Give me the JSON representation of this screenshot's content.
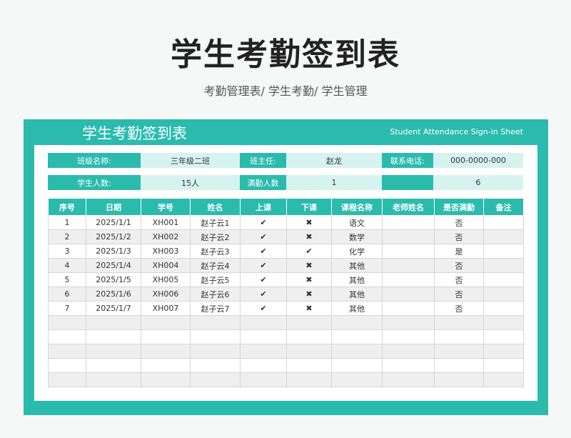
{
  "header": {
    "title": "学生考勤签到表",
    "subtitle": "考勤管理表/ 学生考勤/ 学生管理"
  },
  "sheet": {
    "title_cn": "学生考勤签到表",
    "title_en": "Student Attendance Sign-in Sheet"
  },
  "info": {
    "class_label": "班级名称:",
    "class_value": "三年级二班",
    "teacher_label": "班主任:",
    "teacher_value": "赵龙",
    "phone_label": "联系电话:",
    "phone_value": "000-0000-000",
    "students_label": "学生人数:",
    "students_value": "15人",
    "full_label": "满勤人数",
    "full_value": "1",
    "blank_label": "",
    "extra_value": "6"
  },
  "table": {
    "headers": [
      "序号",
      "日期",
      "学号",
      "姓名",
      "上课",
      "下课",
      "课程名称",
      "老师姓名",
      "是否满勤",
      "备注"
    ],
    "rows": [
      [
        "1",
        "2025/1/1",
        "XH001",
        "赵子云1",
        "✔",
        "✖",
        "语文",
        "",
        "否",
        ""
      ],
      [
        "2",
        "2025/1/2",
        "XH002",
        "赵子云2",
        "✔",
        "✖",
        "数学",
        "",
        "否",
        ""
      ],
      [
        "3",
        "2025/1/3",
        "XH003",
        "赵子云3",
        "✔",
        "✔",
        "化学",
        "",
        "是",
        ""
      ],
      [
        "4",
        "2025/1/4",
        "XH004",
        "赵子云4",
        "✔",
        "✖",
        "其他",
        "",
        "否",
        ""
      ],
      [
        "5",
        "2025/1/5",
        "XH005",
        "赵子云5",
        "✔",
        "✖",
        "其他",
        "",
        "否",
        ""
      ],
      [
        "6",
        "2025/1/6",
        "XH006",
        "赵子云6",
        "✔",
        "✖",
        "其他",
        "",
        "否",
        ""
      ],
      [
        "7",
        "2025/1/7",
        "XH007",
        "赵子云7",
        "✔",
        "✖",
        "其他",
        "",
        "否",
        ""
      ],
      [
        "",
        "",
        "",
        "",
        "",
        "",
        "",
        "",
        "",
        ""
      ],
      [
        "",
        "",
        "",
        "",
        "",
        "",
        "",
        "",
        "",
        ""
      ],
      [
        "",
        "",
        "",
        "",
        "",
        "",
        "",
        "",
        "",
        ""
      ],
      [
        "",
        "",
        "",
        "",
        "",
        "",
        "",
        "",
        "",
        ""
      ],
      [
        "",
        "",
        "",
        "",
        "",
        "",
        "",
        "",
        "",
        ""
      ]
    ]
  },
  "colors": {
    "accent": "#2bbbad",
    "accent_light": "#d7f3f0",
    "row_alt": "#efefef"
  }
}
